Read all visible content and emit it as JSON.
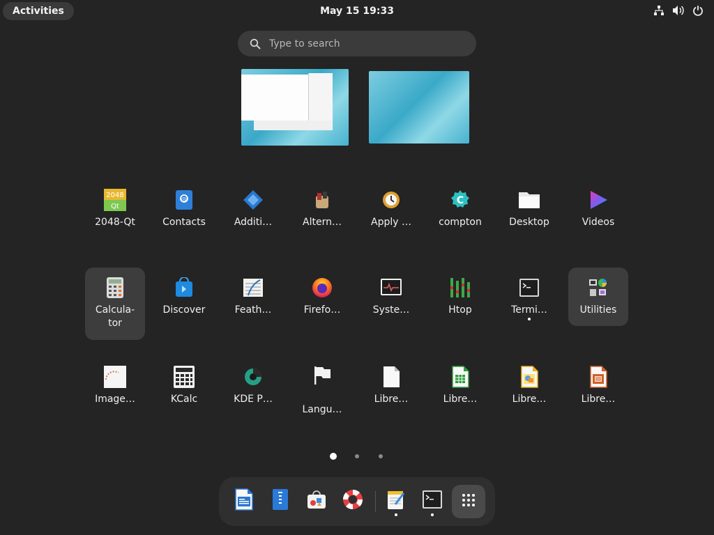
{
  "topbar": {
    "activities_label": "Activities",
    "clock": "May 15  19:33",
    "tray": [
      {
        "icon": "network-wired-icon"
      },
      {
        "icon": "volume-icon"
      },
      {
        "icon": "power-icon"
      }
    ]
  },
  "search": {
    "placeholder": "Type to search",
    "icon": "search-icon"
  },
  "workspaces": [
    {
      "name": "workspace-1"
    },
    {
      "name": "workspace-2"
    }
  ],
  "apps": [
    {
      "label": "2048-Qt",
      "icon": "2048-qt-icon",
      "selected": false
    },
    {
      "label": "Contacts",
      "icon": "contacts-icon",
      "selected": false
    },
    {
      "label": "Additi…",
      "icon": "additional-drivers-icon",
      "selected": false
    },
    {
      "label": "Altern…",
      "icon": "alternatives-icon",
      "selected": false
    },
    {
      "label": "Apply …",
      "icon": "apply-icon",
      "selected": false
    },
    {
      "label": "compton",
      "icon": "compton-icon",
      "selected": false
    },
    {
      "label": "Desktop",
      "icon": "folder-icon",
      "selected": false
    },
    {
      "label": "Videos",
      "icon": "videos-icon",
      "selected": false
    },
    {
      "label": "Calcula-\ntor",
      "icon": "calculator-icon",
      "selected": true
    },
    {
      "label": "Discover",
      "icon": "discover-icon",
      "selected": false
    },
    {
      "label": "Feath…",
      "icon": "feather-icon",
      "selected": false
    },
    {
      "label": "Firefo…",
      "icon": "firefox-icon",
      "selected": false
    },
    {
      "label": "Syste…",
      "icon": "system-monitor-icon",
      "selected": false
    },
    {
      "label": "Htop",
      "icon": "htop-icon",
      "selected": false
    },
    {
      "label": "Termi…",
      "icon": "terminal-icon",
      "selected": false,
      "running": true
    },
    {
      "label": "Utilities",
      "icon": "utilities-folder-icon",
      "selected": true
    },
    {
      "label": "Image…",
      "icon": "image-viewer-icon",
      "selected": false
    },
    {
      "label": "KCalc",
      "icon": "kcalc-icon",
      "selected": false
    },
    {
      "label": "KDE P…",
      "icon": "kde-partition-icon",
      "selected": false
    },
    {
      "label": "\nLangu…",
      "icon": "language-flag-icon",
      "selected": false
    },
    {
      "label": "Libre…",
      "icon": "libreoffice-icon",
      "selected": false
    },
    {
      "label": "Libre…",
      "icon": "libreoffice-calc-icon",
      "selected": false
    },
    {
      "label": "Libre…",
      "icon": "libreoffice-draw-icon",
      "selected": false
    },
    {
      "label": "Libre…",
      "icon": "libreoffice-impress-icon",
      "selected": false
    }
  ],
  "pager": {
    "pages": 3,
    "current": 1
  },
  "dock": [
    {
      "icon": "libreoffice-writer-icon"
    },
    {
      "icon": "document-viewer-icon"
    },
    {
      "icon": "software-store-icon"
    },
    {
      "icon": "help-icon"
    },
    {
      "icon": "text-editor-icon",
      "running": true
    },
    {
      "icon": "terminal-icon",
      "running": true
    },
    {
      "icon": "show-apps-icon"
    }
  ]
}
